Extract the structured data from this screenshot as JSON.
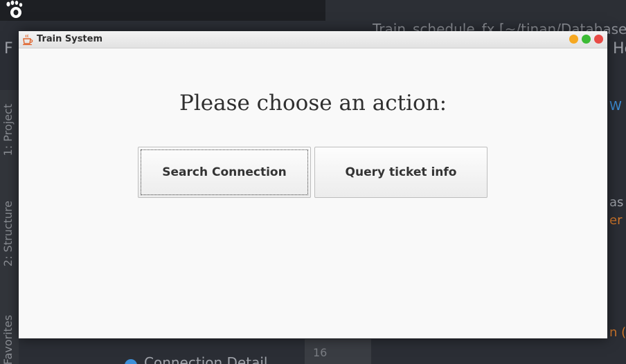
{
  "desktop": {
    "ide_title_fragment": "Train_schedule_fx [~/tinan/Database_",
    "ide_menu_left_fragment": "F",
    "ide_menu_right_fragment": "He",
    "sidebar_tabs": [
      "1: Project",
      "2: Structure",
      "Favorites"
    ],
    "right_fragments": [
      "W",
      "as",
      "er",
      "n ("
    ],
    "bottom_panel_text": "Connection Detail",
    "bottom_line_number": "16"
  },
  "window": {
    "title": "Train System",
    "app_icon": "java-cup-icon",
    "controls": {
      "minimize_color": "#f6a821",
      "maximize_color": "#3cbb35",
      "close_color": "#e84b46"
    }
  },
  "main": {
    "prompt": "Please choose an action:",
    "search_button_label": "Search Connection",
    "query_button_label": "Query ticket info"
  }
}
